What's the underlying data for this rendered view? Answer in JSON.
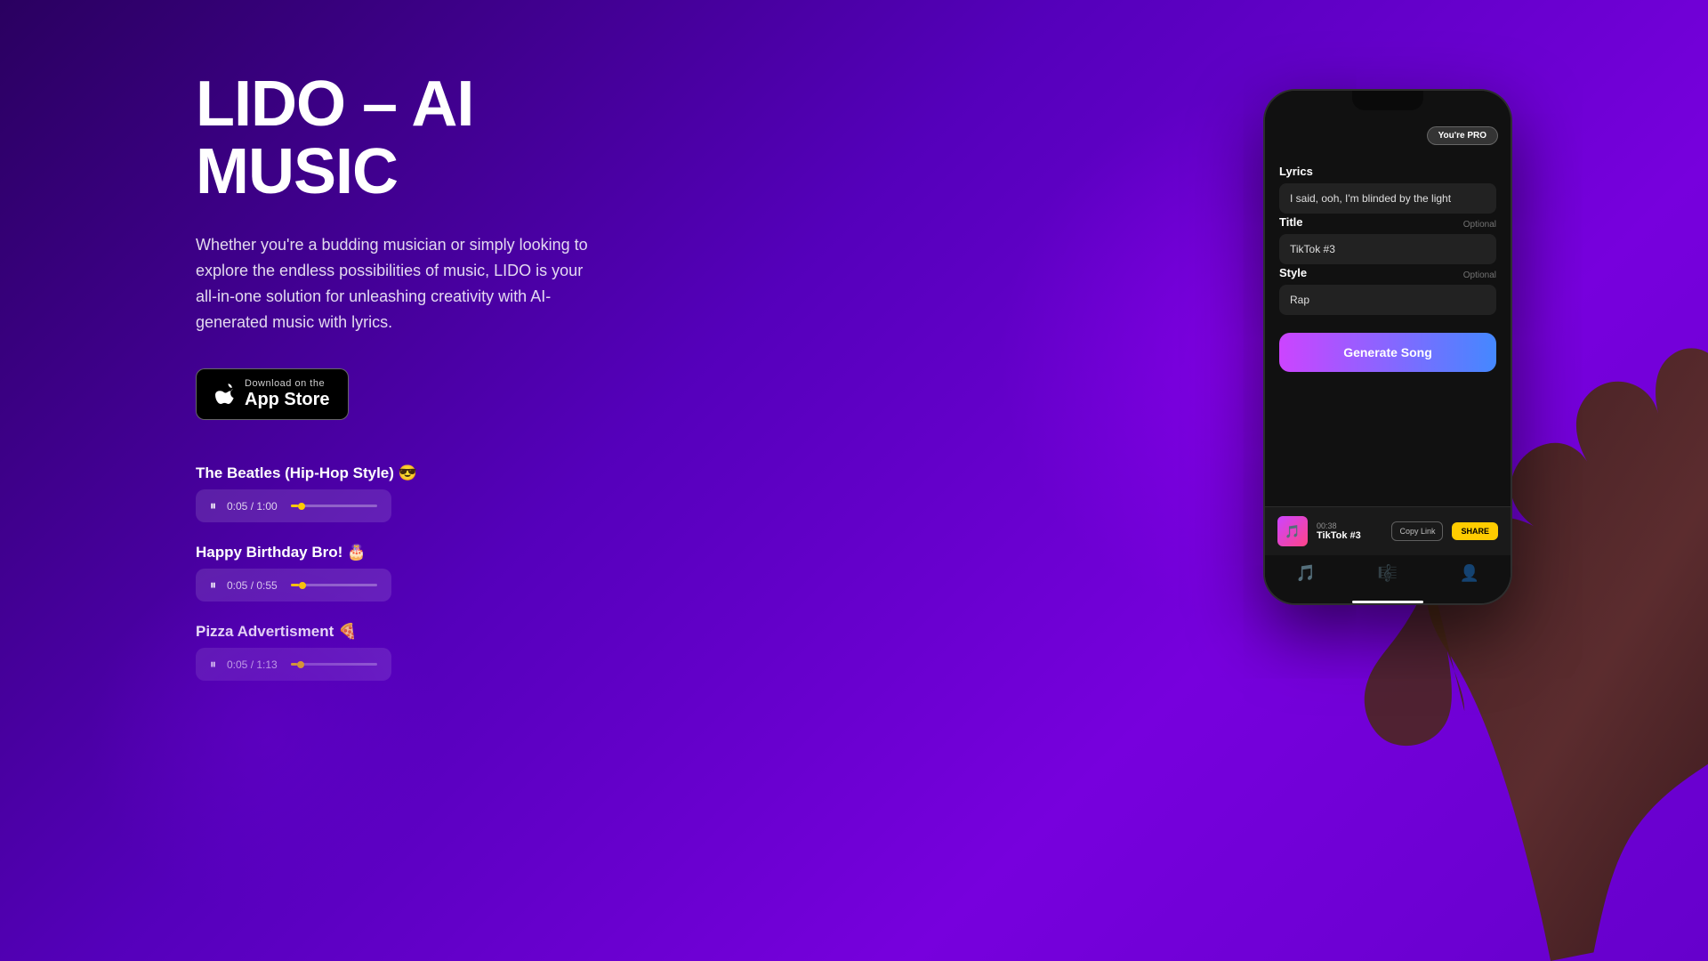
{
  "hero": {
    "title_line1": "LIDO – AI",
    "title_line2": "MUSIC",
    "description": "Whether you're a budding musician or simply looking to explore the endless possibilities of music, LIDO is your all-in-one solution for unleashing creativity with AI-generated music with lyrics."
  },
  "app_store_button": {
    "download_on": "Download on the",
    "store_name": "App Store"
  },
  "tracks": [
    {
      "title": "The Beatles (Hip-Hop Style) 😎",
      "current_time": "0:05",
      "total_time": "1:00",
      "progress_pct": 8
    },
    {
      "title": "Happy Birthday Bro! 🎂",
      "current_time": "0:05",
      "total_time": "0:55",
      "progress_pct": 9
    },
    {
      "title": "Pizza Advertisment 🍕",
      "current_time": "0:05",
      "total_time": "1:13",
      "progress_pct": 7
    }
  ],
  "phone": {
    "pro_badge": "You're PRO",
    "form": {
      "lyrics_label": "Lyrics",
      "lyrics_value": "I said, ooh, I'm blinded by the light",
      "title_label": "Title",
      "title_optional": "Optional",
      "title_value": "TikTok #3",
      "style_label": "Style",
      "style_optional": "Optional",
      "style_value": "Rap",
      "generate_button": "Generate Song"
    },
    "player": {
      "time": "00:38",
      "song_name": "TikTok #3",
      "copy_link": "Copy Link",
      "share": "SHARE"
    },
    "nav": {
      "icons": [
        "🎵",
        "🎼",
        "👤"
      ]
    }
  }
}
